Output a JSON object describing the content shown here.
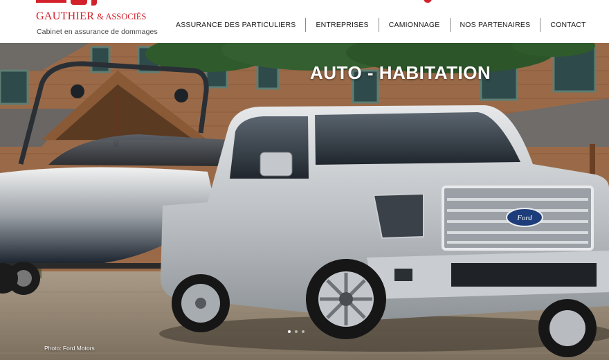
{
  "brand": {
    "name": "GAUTHIER",
    "suffix": "& ASSOCIÉS",
    "tagline": "Cabinet en assurance de dommages",
    "accent_color": "#d3212b"
  },
  "nav": {
    "items": [
      {
        "label": "ASSURANCE DES PARTICULIERS"
      },
      {
        "label": "ENTREPRISES"
      },
      {
        "label": "CAMIONNAGE"
      },
      {
        "label": "NOS PARTENAIRES"
      },
      {
        "label": "CONTACT"
      }
    ]
  },
  "hero": {
    "title": "AUTO - HABITATION",
    "photo_credit": "Photo: Ford Motors",
    "badge_text": "Ford",
    "slides": 3,
    "active_slide": 1
  }
}
